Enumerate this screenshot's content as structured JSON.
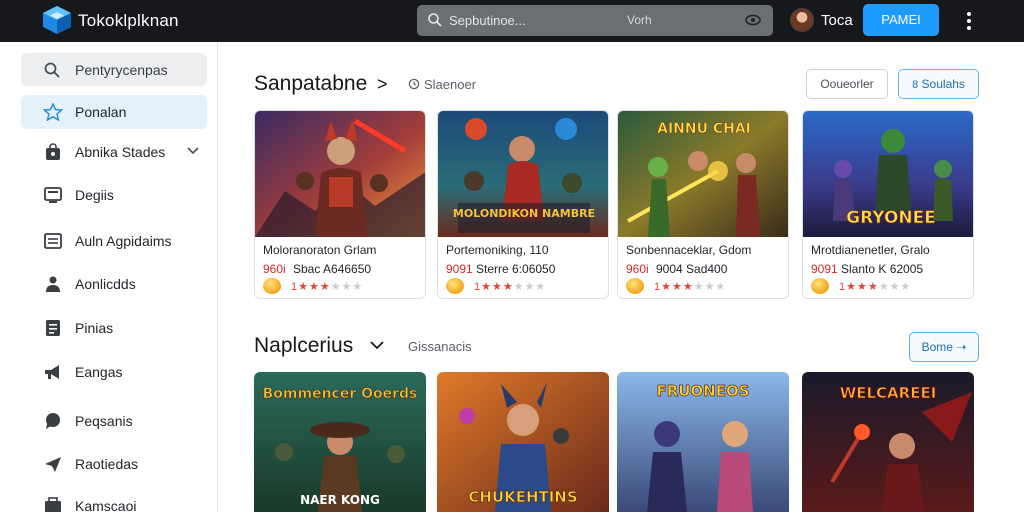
{
  "app": {
    "brand": "Tokoklplknan",
    "search": {
      "placeholder": "Sepbutinoe...",
      "hint": "Vorh"
    },
    "user_name": "Toca",
    "top_button": "PAMEI"
  },
  "sidebar": {
    "search_label": "Pentyrycenpas",
    "items": [
      {
        "label": "Ponalan",
        "icon": "star-icon",
        "active": true
      },
      {
        "label": "Abnika Stades",
        "icon": "bag-icon",
        "has_chevron": true
      },
      {
        "label": "Degiis",
        "icon": "monitor-icon"
      },
      {
        "label": "Auln Agpidaims",
        "icon": "list-icon"
      },
      {
        "label": "Aonlicdds",
        "icon": "person-icon"
      },
      {
        "label": "Pinias",
        "icon": "document-icon"
      },
      {
        "label": "Eangas",
        "icon": "megaphone-icon"
      },
      {
        "label": "Peqsanis",
        "icon": "chat-icon"
      },
      {
        "label": "Raotiedas",
        "icon": "send-icon"
      },
      {
        "label": "Kamscaoi",
        "icon": "box-icon"
      }
    ]
  },
  "section1": {
    "title": "Sanpatabne",
    "arrow": ">",
    "sub": "Slaenoer",
    "btn_grey": "Ooueorler",
    "btn_blue": "Soulahs",
    "cards": [
      {
        "title": "Moloranoraton Grlam",
        "price": "960i",
        "detail": "Sbac A646650",
        "stars": 5,
        "rating_on": 2,
        "art_title": ""
      },
      {
        "title": "Portemoniking, 110",
        "price": "9091",
        "detail": "Sterre 6:06050",
        "stars": 5,
        "rating_on": 3,
        "art_title": "MOLONDIKON NAMBRE"
      },
      {
        "title": "Sonbennaceklar, Gdom",
        "price": "960i",
        "detail": "9004 Sad400",
        "stars": 5,
        "rating_on": 3,
        "art_title": "AINNU CHAI"
      },
      {
        "title": "Mrotdianenetler, Gralo",
        "price": "9091",
        "detail": "Slanto K 62005",
        "stars": 5,
        "rating_on": 3,
        "art_title": "GRYONEE"
      }
    ]
  },
  "section2": {
    "title": "Naplcerius",
    "sub": "Gissanacis",
    "btn_blue": "Bome",
    "cards": [
      {
        "art_title": "Bommencer Ooerds",
        "art_sub": "NAER KONG"
      },
      {
        "art_title": "CHUKEHTINS",
        "art_sub": ""
      },
      {
        "art_title": "FRUONEOS",
        "art_sub": ""
      },
      {
        "art_title": "WELCAREEI",
        "art_sub": ""
      }
    ]
  },
  "colors": {
    "topbar": "#16181c",
    "accent": "#1e9bff",
    "price_red": "#d12b2b",
    "sidebar_active": "#e4f1fb"
  }
}
